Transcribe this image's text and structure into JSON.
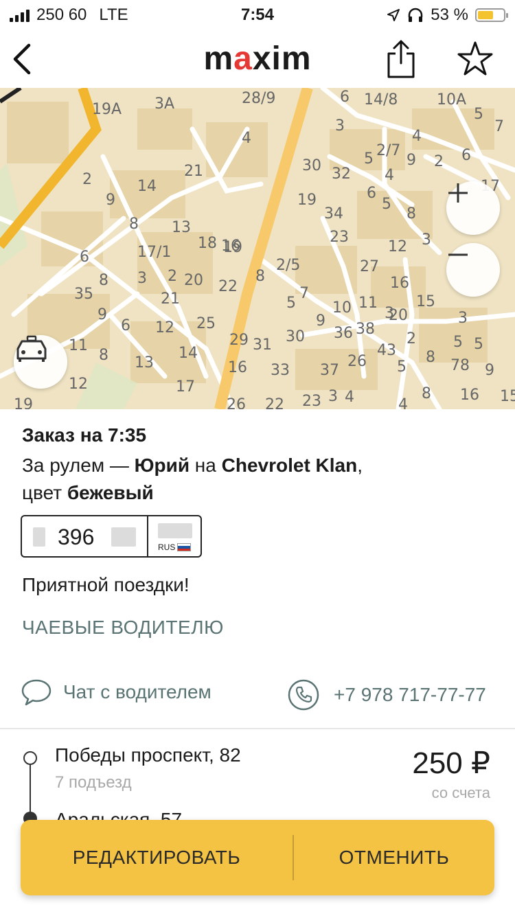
{
  "status_bar": {
    "carrier": "250 60",
    "network": "LTE",
    "time": "7:54",
    "battery": "53 %",
    "battery_level": 0.53
  },
  "header": {
    "logo_dark_1": "m",
    "logo_red": "a",
    "logo_dark_2": "xim"
  },
  "map": {
    "labels": [
      "19A",
      "3A",
      "28/9",
      "6",
      "14/8",
      "10A",
      "5",
      "7",
      "17",
      "2",
      "21",
      "4",
      "3",
      "2/7",
      "5",
      "9",
      "2",
      "6",
      "4",
      "9",
      "14",
      "30",
      "32",
      "4",
      "8",
      "13",
      "16",
      "19",
      "34",
      "6",
      "5",
      "8",
      "3",
      "17/1",
      "18",
      "19",
      "23",
      "12",
      "6",
      "8",
      "3",
      "2",
      "20",
      "22",
      "8",
      "2/5",
      "27",
      "35",
      "9",
      "21",
      "7",
      "16",
      "15",
      "5",
      "10",
      "11",
      "20",
      "3",
      "6",
      "12",
      "25",
      "9",
      "36",
      "38",
      "3",
      "11",
      "8",
      "29",
      "31",
      "30",
      "43",
      "2",
      "5",
      "13",
      "14",
      "26",
      "16",
      "33",
      "37",
      "5",
      "78",
      "9",
      "12",
      "17",
      "23",
      "3",
      "4",
      "8",
      "16",
      "15",
      "19",
      "26",
      "22",
      "4",
      "5",
      "8",
      "6"
    ]
  },
  "order": {
    "title": "Заказ на 7:35",
    "driver_prefix": "За рулем — ",
    "driver_name": "Юрий",
    "driver_mid": " на ",
    "car": "Chevrolet Klan",
    "car_suffix": ",",
    "color_prefix": "цвет ",
    "color": "бежевый"
  },
  "plate": {
    "number": "396",
    "country": "RUS"
  },
  "message": "Приятной поездки!",
  "tips_label": "ЧАЕВЫЕ ВОДИТЕЛЮ",
  "chat_label": "Чат с водителем",
  "phone_number": "+7 978 717-77-77",
  "route": {
    "from": "Победы проспект, 82",
    "entrance": "7 подъезд",
    "to": "Аральская, 57"
  },
  "price": {
    "amount": "250 ₽",
    "payment": "со счета"
  },
  "actions": {
    "edit": "РЕДАКТИРОВАТЬ",
    "cancel": "ОТМЕНИТЬ"
  },
  "colors": {
    "accent": "#f5c343",
    "link": "#5a7373",
    "brand_red": "#e53935"
  }
}
